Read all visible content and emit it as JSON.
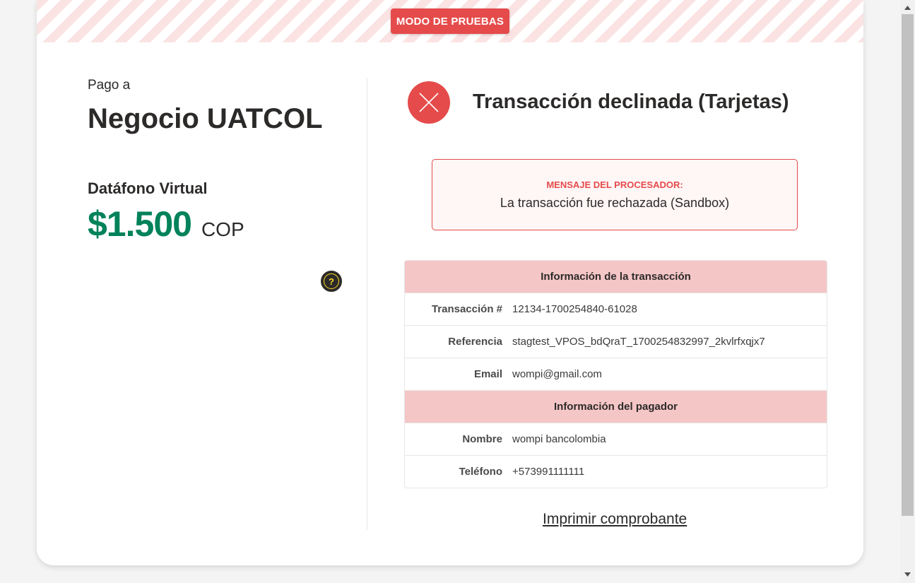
{
  "banner": {
    "test_mode": "MODO DE PRUEBAS"
  },
  "payment": {
    "pay_to_label": "Pago a",
    "merchant_name": "Negocio UATCOL",
    "product_name": "Datáfono Virtual",
    "amount": "$1.500",
    "currency": "COP",
    "help_symbol": "?"
  },
  "status": {
    "icon": "close-x-icon",
    "title": "Transacción declinada (Tarjetas)",
    "color": "#e54b4b"
  },
  "processor": {
    "label": "MENSAJE DEL PROCESADOR:",
    "message": "La transacción fue rechazada (Sandbox)"
  },
  "transaction_info": {
    "header": "Información de la transacción",
    "rows": [
      {
        "label": "Transacción #",
        "value": "12134-1700254840-61028"
      },
      {
        "label": "Referencia",
        "value": "stagtest_VPOS_bdQraT_1700254832997_2kvlrfxqjx7"
      },
      {
        "label": "Email",
        "value": "wompi@gmail.com"
      }
    ]
  },
  "payer_info": {
    "header": "Información del pagador",
    "rows": [
      {
        "label": "Nombre",
        "value": "wompi bancolombia"
      },
      {
        "label": "Teléfono",
        "value": "+573991111111"
      }
    ]
  },
  "actions": {
    "print_receipt": "Imprimir comprobante"
  },
  "colors": {
    "accent_red": "#e54b4b",
    "amount_green": "#00825a",
    "section_header_bg": "#f5c6c6",
    "help_yellow": "#fdda24"
  }
}
